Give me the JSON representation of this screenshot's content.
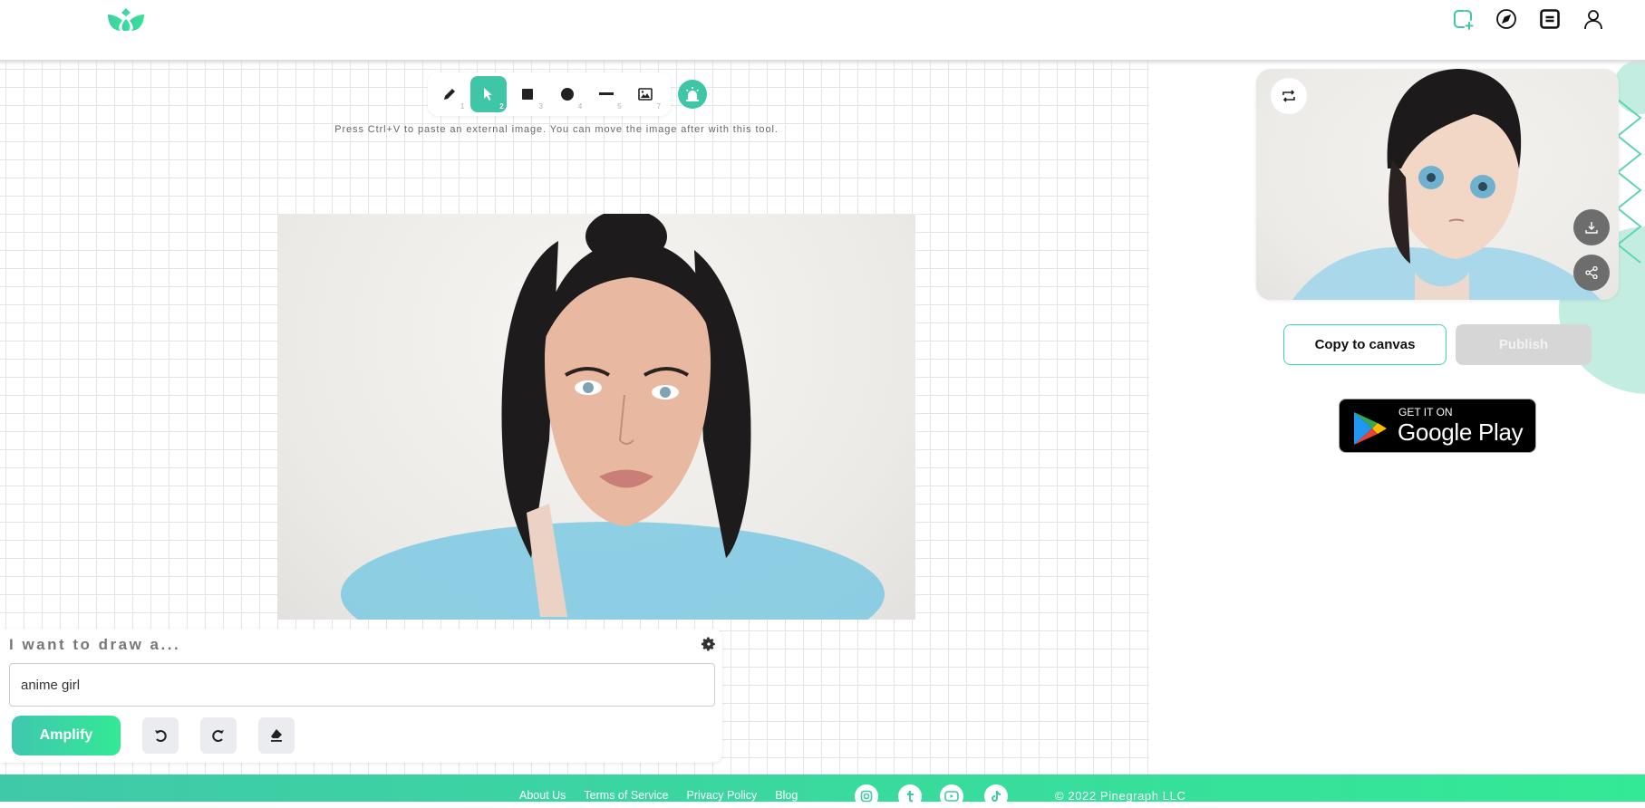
{
  "header": {
    "logo": "pinegraph-logo",
    "nav": [
      {
        "name": "new-canvas-icon",
        "color": "#3fc6a6"
      },
      {
        "name": "compass-icon",
        "color": "#111111"
      },
      {
        "name": "feed-icon",
        "color": "#111111"
      },
      {
        "name": "user-icon",
        "color": "#111111"
      }
    ]
  },
  "toolbar": {
    "tools": [
      {
        "name": "pencil",
        "shortcut": "1",
        "active": false
      },
      {
        "name": "select",
        "shortcut": "2",
        "active": true
      },
      {
        "name": "rectangle",
        "shortcut": "3",
        "active": false
      },
      {
        "name": "circle",
        "shortcut": "4",
        "active": false
      },
      {
        "name": "line",
        "shortcut": "5",
        "active": false
      },
      {
        "name": "image",
        "shortcut": "7",
        "active": false
      }
    ],
    "hint": "Press Ctrl+V to paste an external image. You can move the image after with this tool."
  },
  "canvas": {
    "image_description": "Portrait photo of a woman with dark hair in an updo, blue feathered top, white background"
  },
  "prompt": {
    "label": "I want to draw a...",
    "value": "anime girl",
    "amplify_label": "Amplify",
    "undo": "undo-icon",
    "redo": "redo-icon",
    "clear": "eraser-icon"
  },
  "result": {
    "image_description": "Anime-style illustration of a girl with dark hair and blue eyes, light blue clothing",
    "copy_label": "Copy to canvas",
    "publish_label": "Publish",
    "gplay_small": "GET IT ON",
    "gplay_big": "Google Play"
  },
  "footer": {
    "links": [
      "About Us",
      "Terms of Service",
      "Privacy Policy",
      "Blog"
    ],
    "social": [
      "instagram",
      "tumblr",
      "youtube",
      "tiktok"
    ],
    "copyright": "© 2022 Pinegraph LLC"
  },
  "colors": {
    "accent": "#3fc6a6",
    "gradient_start": "#40c9a8",
    "gradient_end": "#33e995"
  }
}
